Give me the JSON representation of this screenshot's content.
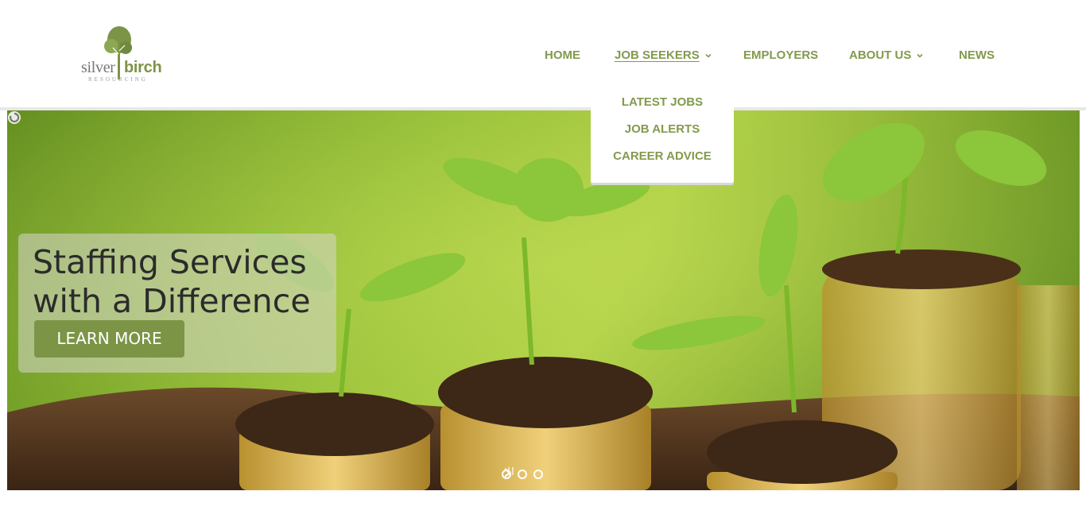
{
  "logo": {
    "word1": "silver",
    "word2": "birch",
    "tagline": "RESOURCING"
  },
  "nav": {
    "home": "HOME",
    "job_seekers": "JOB SEEKERS",
    "employers": "EMPLOYERS",
    "about_us": "ABOUT US",
    "news": "NEWS"
  },
  "dropdown": {
    "items": [
      "LATEST JOBS",
      "JOB ALERTS",
      "CAREER ADVICE"
    ]
  },
  "hero": {
    "title": "Staffing Services with a Difference",
    "button": "LEARN MORE",
    "slide_count": 3
  },
  "colors": {
    "accent": "#829a4d",
    "button": "#7c9446"
  },
  "icons": [
    "tree-logo-icon",
    "chevron-down-icon",
    "chevron-right-icon",
    "pause-icon",
    "loading-spinner-icon"
  ]
}
